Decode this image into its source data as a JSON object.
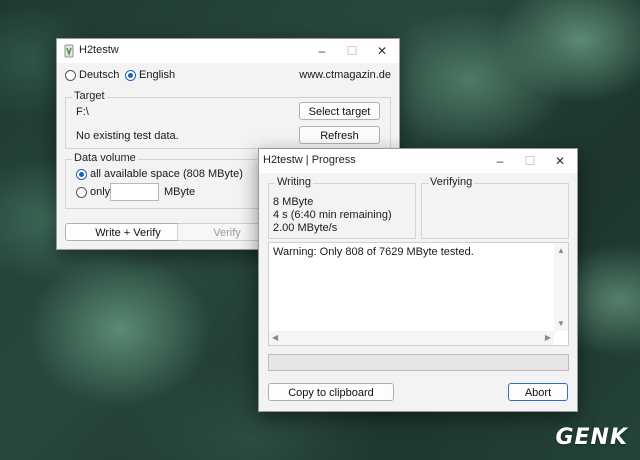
{
  "main_window": {
    "title": "H2testw",
    "language": {
      "options": [
        "Deutsch",
        "English"
      ],
      "selected": "English"
    },
    "website": "www.ctmagazin.de",
    "target": {
      "label": "Target",
      "path": "F:\\",
      "status": "No existing test data.",
      "select_button": "Select target",
      "refresh_button": "Refresh"
    },
    "data_volume": {
      "label": "Data volume",
      "all_option": "all available space (808 MByte)",
      "only_option": "only",
      "only_value": "",
      "unit": "MByte",
      "selected": "all"
    },
    "write_verify_button": "Write + Verify",
    "verify_button": "Verify"
  },
  "progress_window": {
    "title": "H2testw | Progress",
    "writing": {
      "label": "Writing",
      "lines": [
        "8 MByte",
        "4 s (6:40 min remaining)",
        "2.00 MByte/s"
      ]
    },
    "verifying": {
      "label": "Verifying"
    },
    "log_text": "Warning: Only 808 of 7629 MByte tested.",
    "progress_percent": 0,
    "copy_button": "Copy to clipboard",
    "abort_button": "Abort"
  },
  "watermark": {
    "text": "GENK"
  },
  "colors": {
    "accent": "#1f5fb8",
    "progress": "#06b025"
  }
}
